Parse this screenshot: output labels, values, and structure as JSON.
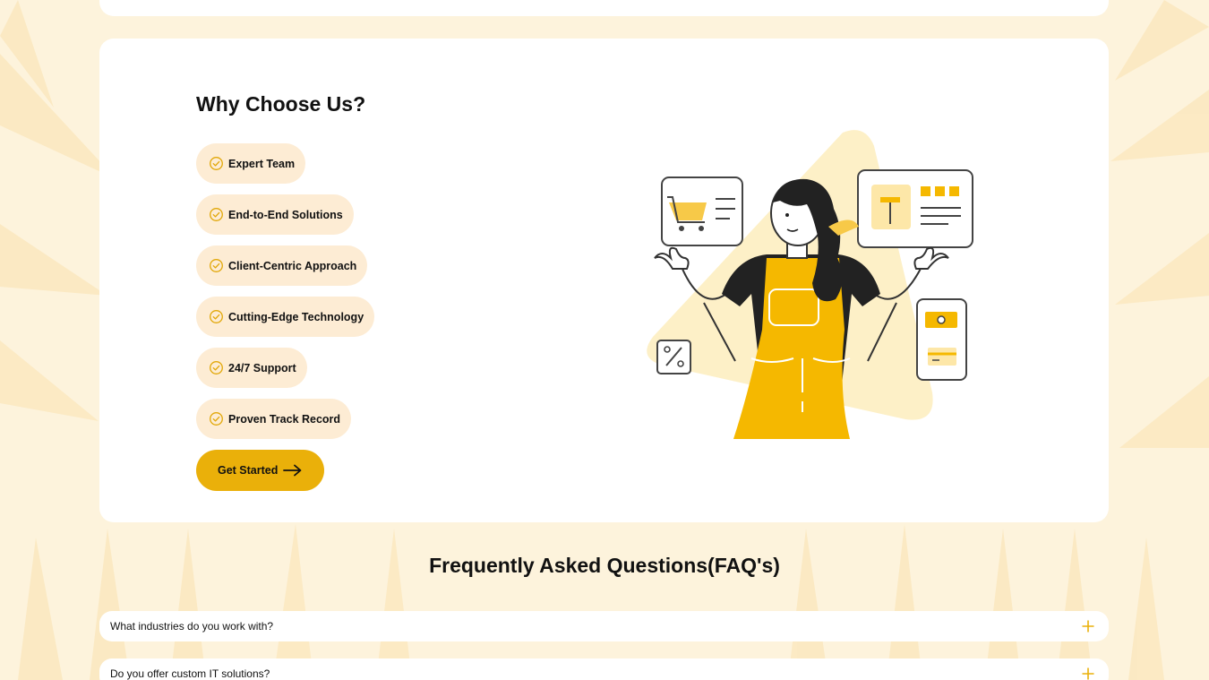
{
  "why_section": {
    "title": "Why Choose Us?",
    "features": [
      {
        "label": "Expert Team",
        "icon": "check-circle-icon"
      },
      {
        "label": "End-to-End Solutions",
        "icon": "check-circle-icon"
      },
      {
        "label": "Client-Centric Approach",
        "icon": "check-circle-icon"
      },
      {
        "label": "Cutting-Edge Technology",
        "icon": "check-circle-icon"
      },
      {
        "label": "24/7 Support",
        "icon": "check-circle-icon"
      },
      {
        "label": "Proven Track Record",
        "icon": "check-circle-icon"
      }
    ],
    "cta": {
      "label": "Get Started",
      "icon": "arrow-right-icon"
    }
  },
  "faq": {
    "title": "Frequently Asked Questions(FAQ's)",
    "items": [
      {
        "question": "What industries do you work with?",
        "icon": "plus-icon"
      },
      {
        "question": "Do you offer custom IT solutions?",
        "icon": "plus-icon"
      }
    ]
  },
  "colors": {
    "accent": "#eab00a",
    "pill_background": "#fdecd4",
    "page_background": "#fdf3dc",
    "card_background": "#ffffff"
  }
}
